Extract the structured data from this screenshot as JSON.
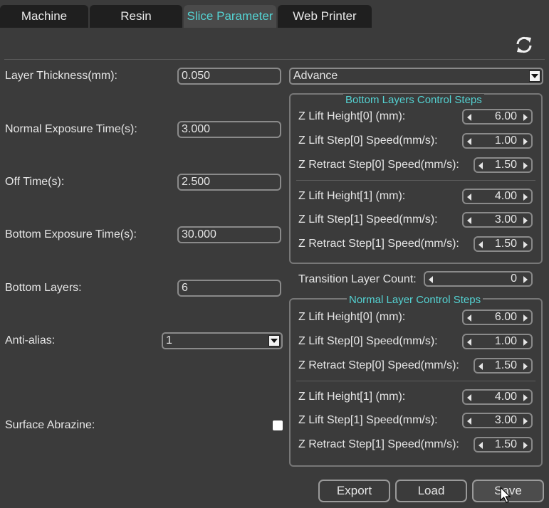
{
  "tabs": [
    {
      "label": "Machine"
    },
    {
      "label": "Resin"
    },
    {
      "label": "Slice Parameter"
    },
    {
      "label": "Web Printer"
    }
  ],
  "left": {
    "layer_thickness": {
      "label": "Layer Thickness(mm):",
      "value": "0.050"
    },
    "normal_exposure": {
      "label": "Normal Exposure Time(s):",
      "value": "3.000"
    },
    "off_time": {
      "label": "Off Time(s):",
      "value": "2.500"
    },
    "bottom_exposure": {
      "label": "Bottom Exposure Time(s):",
      "value": "30.000"
    },
    "bottom_layers": {
      "label": "Bottom Layers:",
      "value": "6"
    },
    "anti_alias": {
      "label": "Anti-alias:",
      "value": "1"
    },
    "surface_abrazine": {
      "label": "Surface Abrazine:",
      "checked": false
    }
  },
  "mode_select": {
    "value": "Advance"
  },
  "bottom_group": {
    "title": "Bottom Layers Control Steps",
    "rows": [
      {
        "label": "Z Lift Height[0] (mm):",
        "value": "6.00"
      },
      {
        "label": "Z Lift Step[0] Speed(mm/s):",
        "value": "1.00"
      },
      {
        "label": "Z Retract Step[0] Speed(mm/s):",
        "value": "1.50"
      },
      {
        "label": "Z Lift Height[1] (mm):",
        "value": "4.00"
      },
      {
        "label": "Z Lift Step[1] Speed(mm/s):",
        "value": "3.00"
      },
      {
        "label": "Z Retract Step[1] Speed(mm/s):",
        "value": "1.50"
      }
    ]
  },
  "transition": {
    "label": "Transition Layer Count:",
    "value": "0"
  },
  "normal_group": {
    "title": "Normal Layer Control Steps",
    "rows": [
      {
        "label": "Z Lift Height[0] (mm):",
        "value": "6.00"
      },
      {
        "label": "Z Lift Step[0] Speed(mm/s):",
        "value": "1.00"
      },
      {
        "label": "Z Retract Step[0] Speed(mm/s):",
        "value": "1.50"
      },
      {
        "label": "Z Lift Height[1] (mm):",
        "value": "4.00"
      },
      {
        "label": "Z Lift Step[1] Speed(mm/s):",
        "value": "3.00"
      },
      {
        "label": "Z Retract Step[1] Speed(mm/s):",
        "value": "1.50"
      }
    ]
  },
  "buttons": {
    "export": "Export",
    "load": "Load",
    "save": "Save"
  },
  "icons": {
    "refresh": "refresh-icon"
  },
  "colors": {
    "background": "#3b3b3b",
    "accent": "#54d2d2",
    "tab_inactive": "#1f1f1f",
    "tab_active": "#4a4a4a"
  }
}
